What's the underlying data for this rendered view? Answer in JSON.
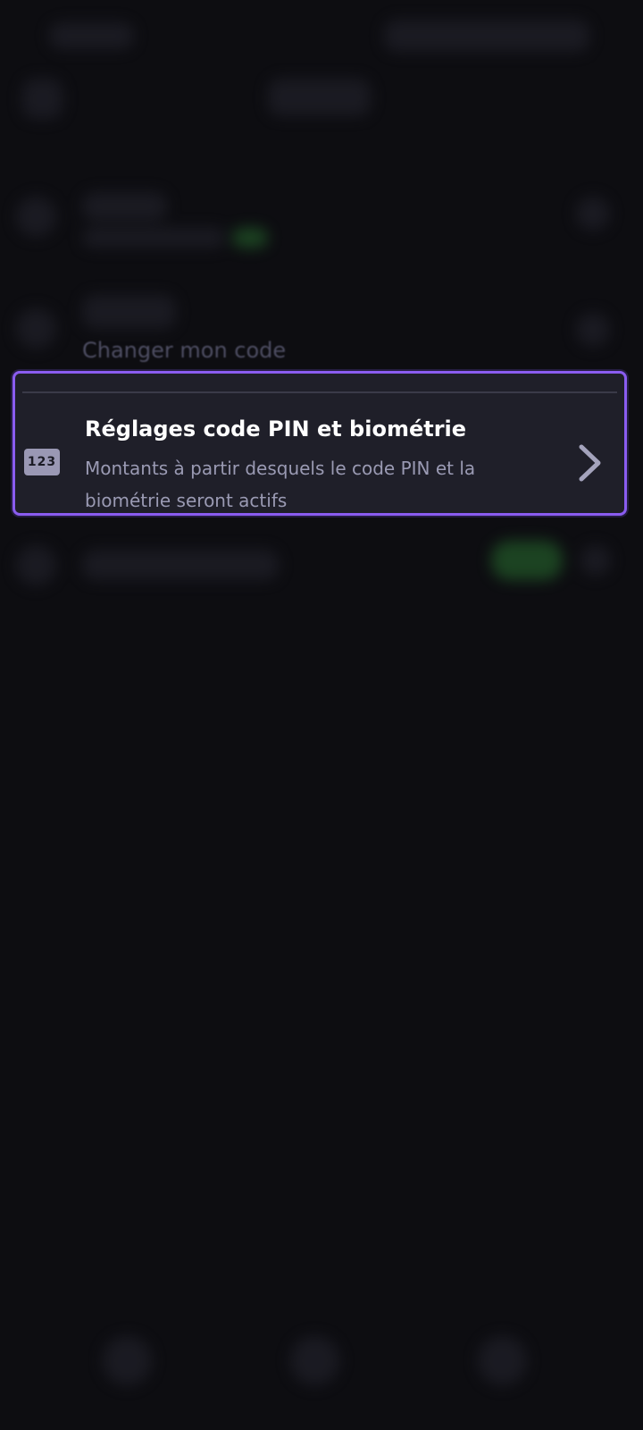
{
  "background": {
    "partial_text": "Changer mon code"
  },
  "pin_settings": {
    "icon_text": "123",
    "title": "Réglages code PIN et biométrie",
    "subtitle": "Montants à partir desquels le code PIN et la biométrie seront actifs"
  },
  "colors": {
    "page_background": "#0d0d11",
    "card_background": "#1f1f29",
    "card_border": "#8a5cf0",
    "subtitle_text": "#9a9ab3",
    "icon_background": "#9a98b4"
  },
  "icons": {
    "pin_icon": "keypad-123-icon",
    "chevron": "chevron-right-icon"
  }
}
